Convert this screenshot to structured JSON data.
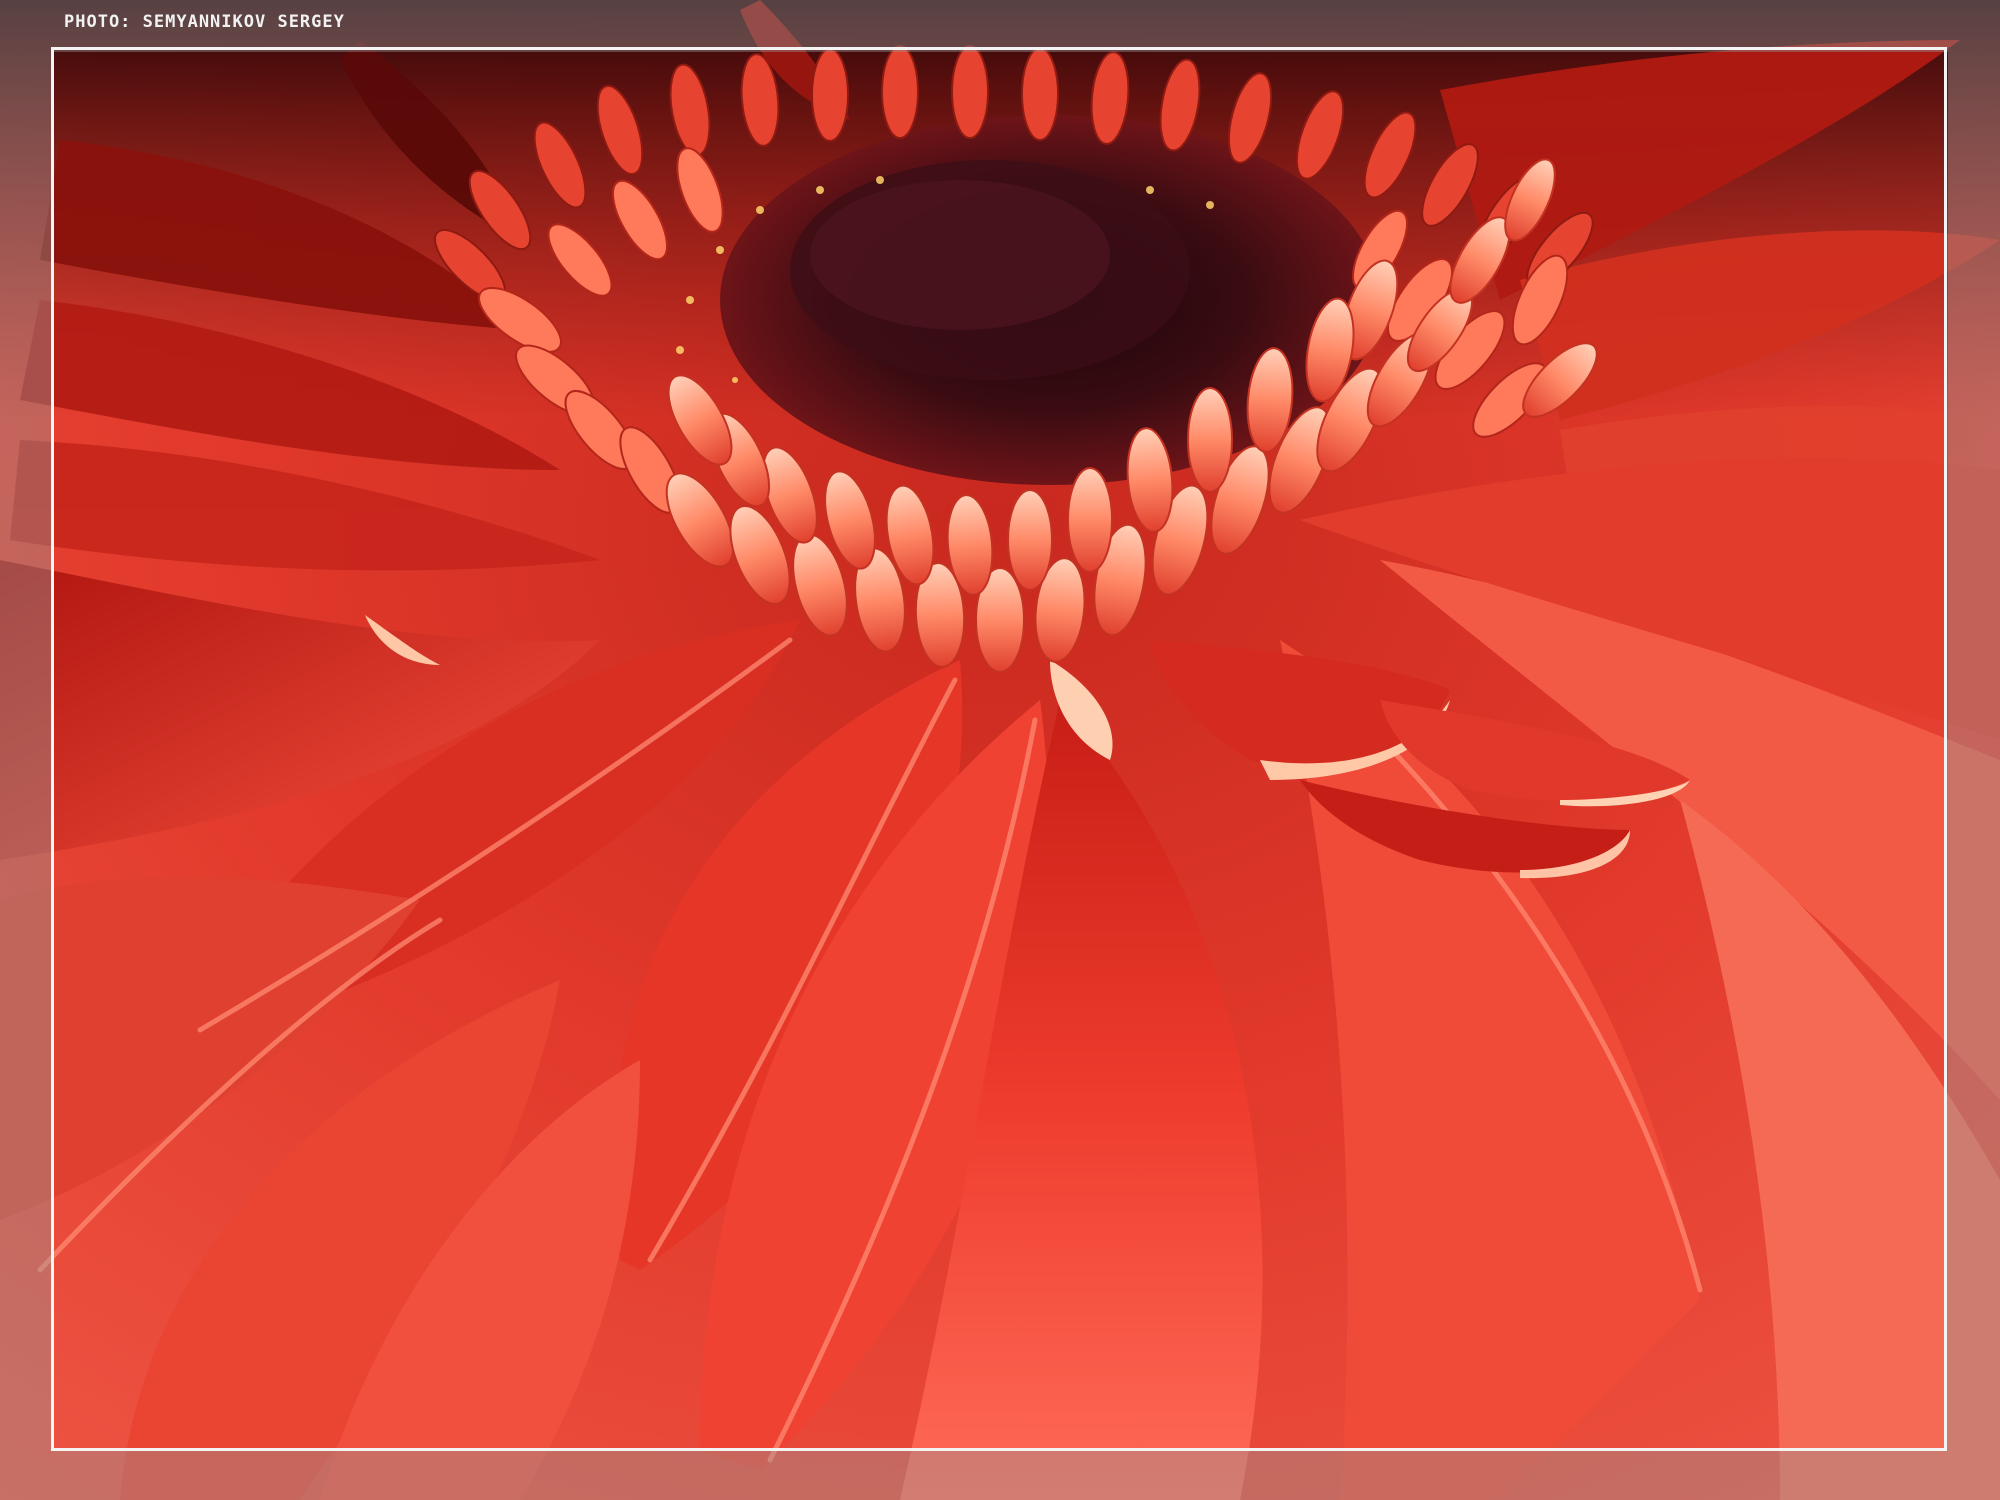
{
  "photo": {
    "credit": "PHOTO: SEMYANNIKOV SERGEY",
    "subject": "red-gerbera-flower-closeup",
    "colors": {
      "petal": "#e8382c",
      "petal_light": "#ff6a55",
      "petal_shadow": "#8c120c",
      "center_dark": "#2a0a0c",
      "floret": "#ff9a78",
      "frame": "#f4f4f4",
      "margin": "#8a8a8a"
    }
  }
}
